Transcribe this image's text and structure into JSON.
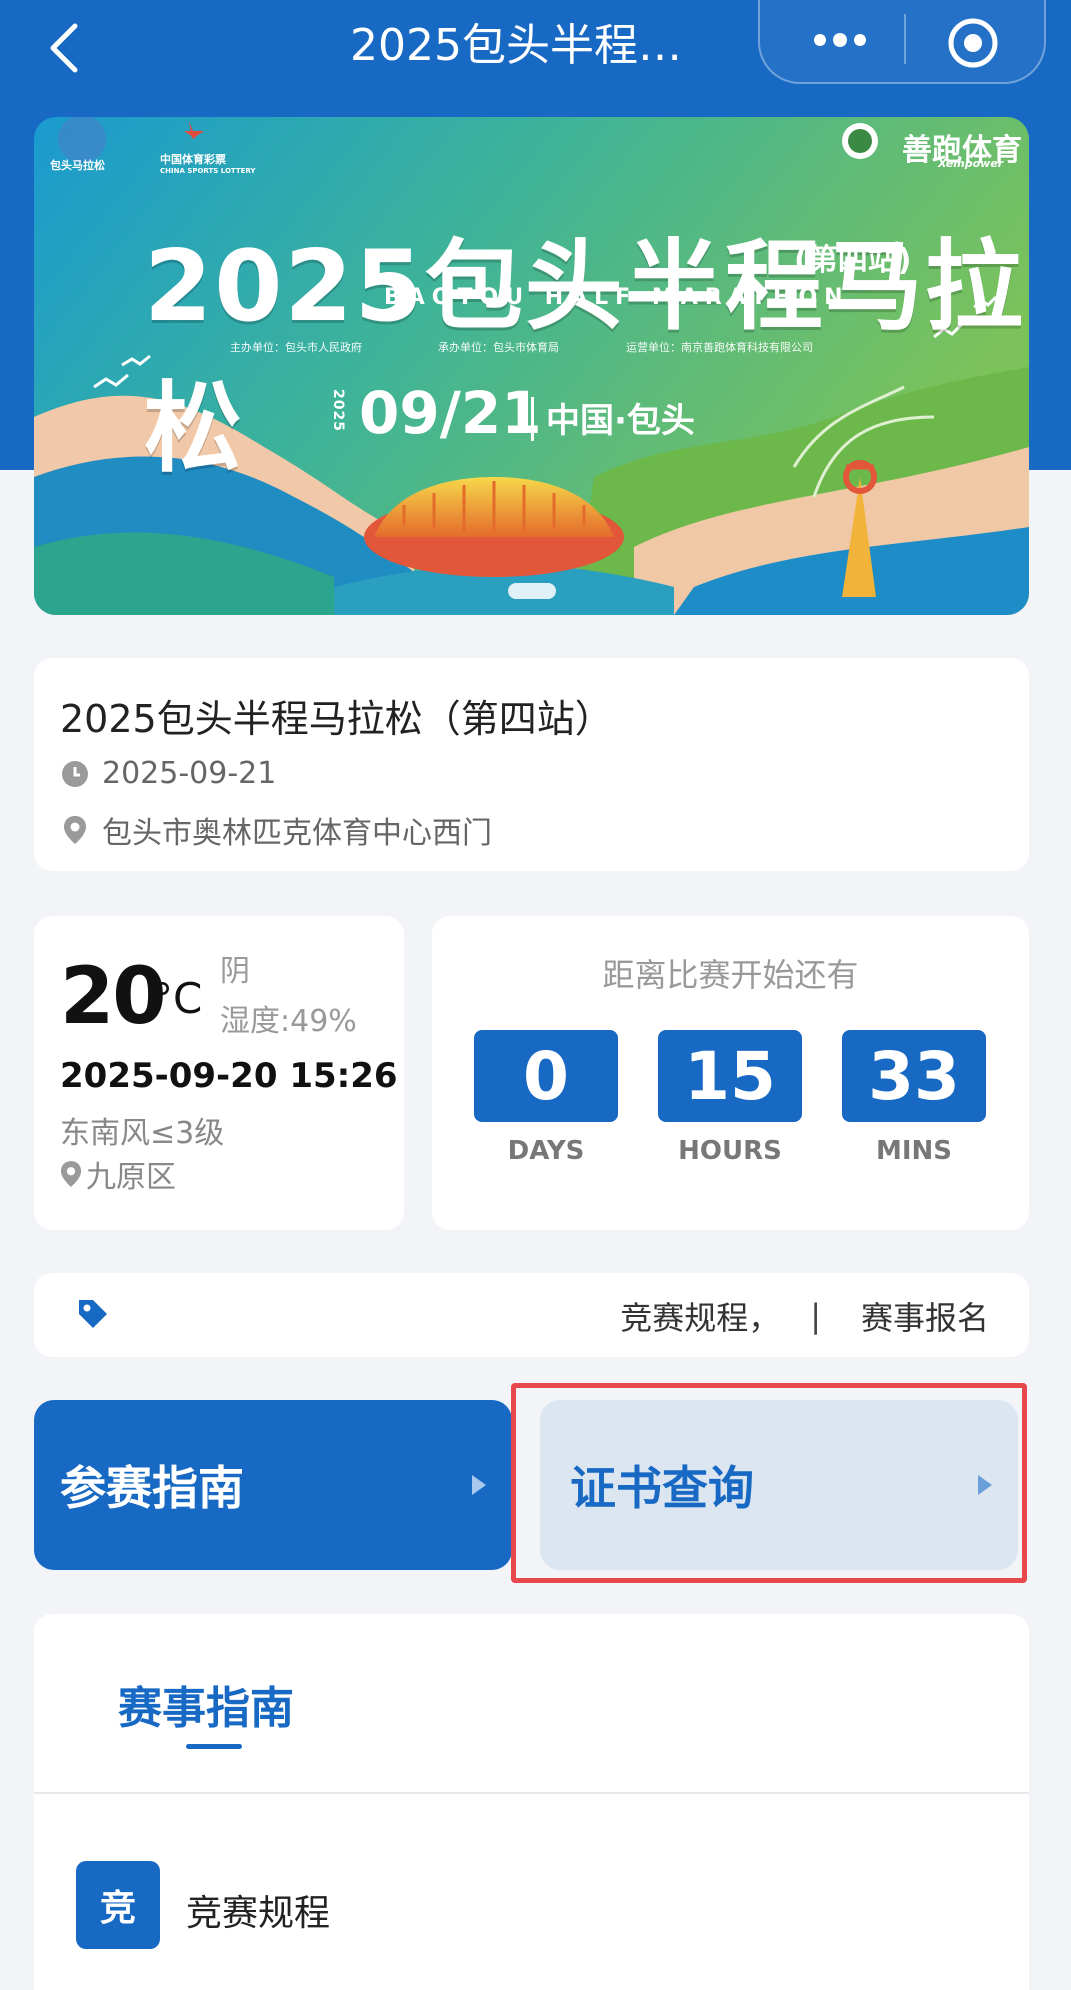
{
  "nav": {
    "title": "2025包头半程…",
    "back_icon": "chevron-left-icon",
    "more_icon": "more-dots-icon",
    "close_icon": "target-close-icon"
  },
  "banner": {
    "title": "2025包头半程马拉松",
    "station": "(第四站)",
    "subtitle": "BAOTOU HALF MARATHON",
    "organizer": "主办单位：包头市人民政府",
    "undertaker": "承办单位：包头市体育局",
    "operator": "运营单位：南京善跑体育科技有限公司",
    "year_vertical": "2025",
    "date": "09/21",
    "place": "中国·包头",
    "logo_left_1": "包头马拉松",
    "logo_left_2": "中国体育彩票",
    "logo_left_2_en": "CHINA SPORTS LOTTERY",
    "logo_right": "善跑体育",
    "logo_right_en": "Xempower"
  },
  "event": {
    "name": "2025包头半程马拉松（第四站）",
    "date": "2025-09-21",
    "location": "包头市奥林匹克体育中心西门"
  },
  "weather": {
    "temperature": "20",
    "unit": "°C",
    "condition": "阴",
    "humidity": "湿度:49%",
    "datetime": "2025-09-20 15:26",
    "wind": "东南风≤3级",
    "district": "九原区"
  },
  "countdown": {
    "title": "距离比赛开始还有",
    "days": "0",
    "hours": "15",
    "mins": "33",
    "days_label": "DAYS",
    "hours_label": "HOURS",
    "mins_label": "MINS"
  },
  "tags": {
    "link1": "竞赛规程，",
    "sep": "|",
    "link2": "赛事报名"
  },
  "actions": {
    "guide": "参赛指南",
    "certificate": "证书查询"
  },
  "guide_section": {
    "tab": "赛事指南",
    "items": [
      {
        "badge": "竞",
        "label": "竞赛规程"
      }
    ]
  },
  "colors": {
    "primary": "#1769c4",
    "highlight_border": "#e8474c",
    "page_bg": "#f2f4f8"
  }
}
